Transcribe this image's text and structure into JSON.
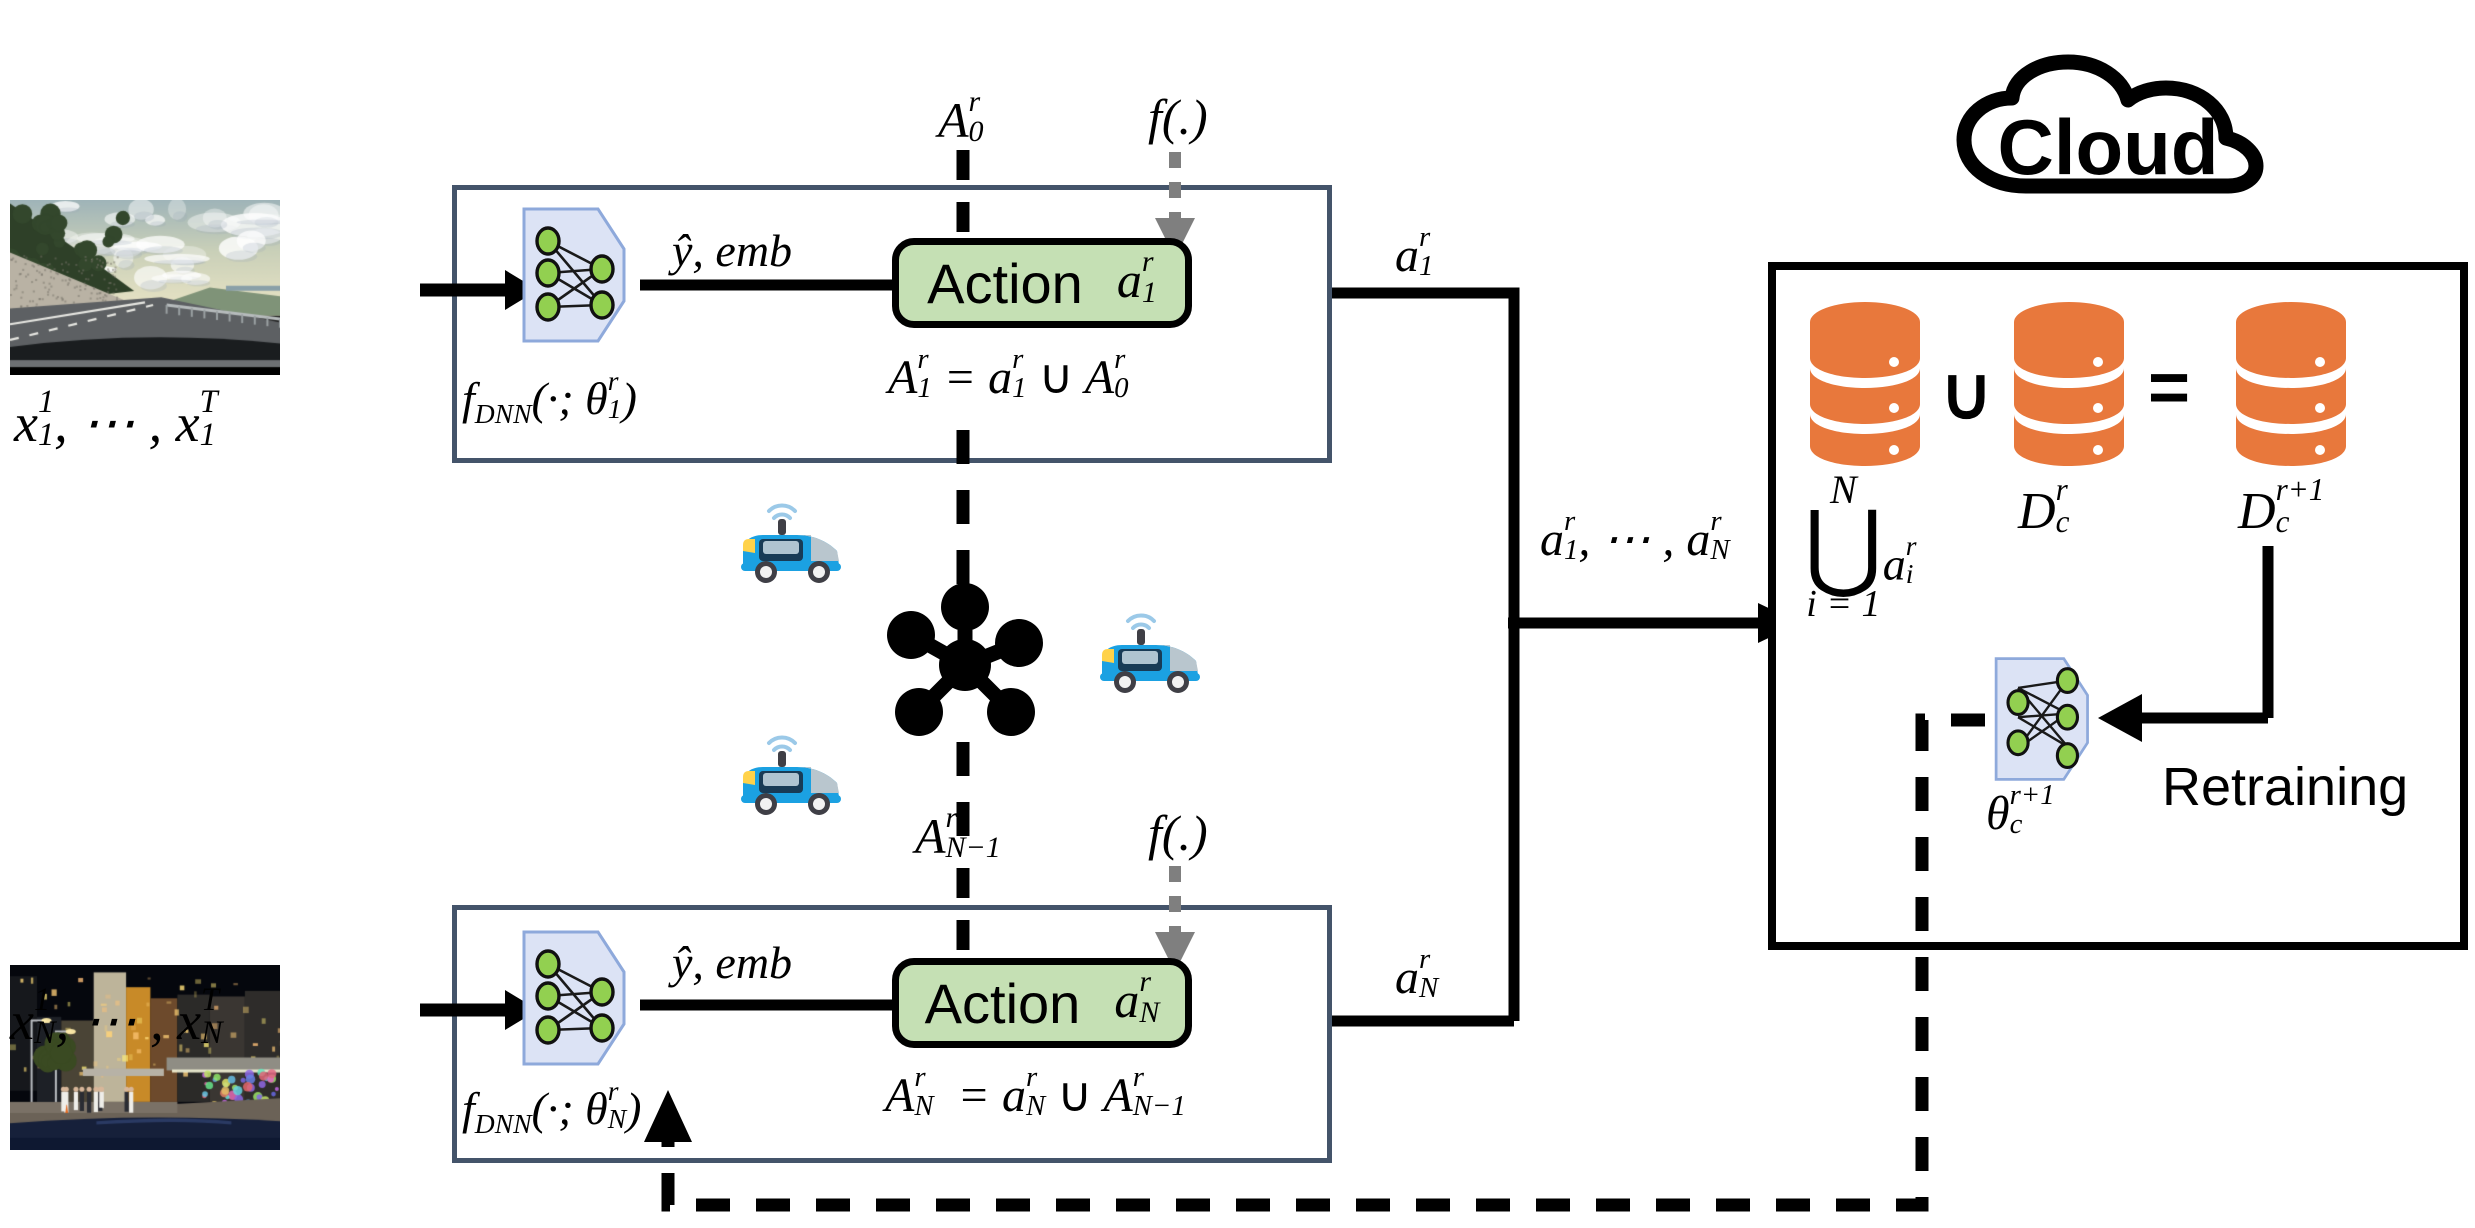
{
  "diagram": {
    "title": "Federated continual learning with edge clients and cloud retraining",
    "colors": {
      "client_border": "#44546A",
      "action_fill": "#C5E0B4",
      "action_border": "#000000",
      "dnn_panel_fill": "#DCE3F5",
      "dnn_panel_border": "#8EA9DB",
      "dnn_node_fill": "#92D050",
      "database_orange": "#E8783C",
      "cloud_border": "#000000",
      "gray_arrow": "#7F7F7F",
      "car_blue": "#1BA1E2"
    }
  },
  "inputs": [
    {
      "id": "client-1",
      "label": "x₁¹, ⋯, x₁ᵀ",
      "scene": "daytime-highway-dashcam",
      "label_parts": {
        "base": "x",
        "sup_first": "1",
        "sub_first": "1",
        "ellipsis": ", ⋯ , ",
        "sup_last": "T",
        "sub_last": "1"
      }
    },
    {
      "id": "client-N",
      "label": "xₙ¹, ⋯, xₙᵀ",
      "scene": "night-street-dashcam",
      "label_parts": {
        "base": "x",
        "sup_first": "1",
        "sub_first": "N",
        "ellipsis": ", ⋯ , ",
        "sup_last": "T",
        "sub_last": "N"
      }
    }
  ],
  "clients": [
    {
      "id": "client-1",
      "dnn_label": {
        "f": "f",
        "subscript": "DNN",
        "args_open": "(·; ",
        "theta": "θ",
        "theta_sup": "r",
        "theta_sub": "1",
        "args_close": ")"
      },
      "edge_label": {
        "yhat": "ŷ",
        "comma": ", ",
        "emb": "emb"
      },
      "action_word": "Action",
      "action_symbol": {
        "base": "a",
        "sup": "r",
        "sub": "1"
      },
      "buffer_in": {
        "base": "A",
        "sup": "r",
        "sub": "0"
      },
      "policy_label": "f(.)",
      "union_equation": {
        "lhs": {
          "base": "A",
          "sup": "r",
          "sub": "1"
        },
        "eq": " = ",
        "term1": {
          "base": "a",
          "sup": "r",
          "sub": "1"
        },
        "op": " ∪ ",
        "term2": {
          "base": "A",
          "sup": "r",
          "sub": "0"
        }
      },
      "out_label": {
        "base": "a",
        "sup": "r",
        "sub": "1"
      }
    },
    {
      "id": "client-N",
      "dnn_label": {
        "f": "f",
        "subscript": "DNN",
        "args_open": "(·; ",
        "theta": "θ",
        "theta_sup": "r",
        "theta_sub": "N",
        "args_close": ")"
      },
      "edge_label": {
        "yhat": "ŷ",
        "comma": ", ",
        "emb": "emb"
      },
      "action_word": "Action",
      "action_symbol": {
        "base": "a",
        "sup": "r",
        "sub": "N"
      },
      "buffer_in": {
        "base": "A",
        "sup": "r",
        "sub": "N−1"
      },
      "policy_label": "f(.)",
      "union_equation": {
        "lhs": {
          "base": "A",
          "sup": "r",
          "sub": "N"
        },
        "eq": " = ",
        "term1": {
          "base": "a",
          "sup": "r",
          "sub": "N"
        },
        "op": " ∪ ",
        "term2": {
          "base": "A",
          "sup": "r",
          "sub": "N−1"
        }
      },
      "out_label": {
        "base": "a",
        "sup": "r",
        "sub": "N"
      }
    }
  ],
  "aggregation": {
    "uplink_label": {
      "first": {
        "base": "a",
        "sup": "r",
        "sub": "1"
      },
      "ellipsis": ", ⋯ , ",
      "last": {
        "base": "a",
        "sup": "r",
        "sub": "N"
      }
    }
  },
  "cloud": {
    "title": "Cloud",
    "databases": [
      {
        "id": "db-union-actions",
        "caption": {
          "big_op": "⋃",
          "upper": "N",
          "lower": "i = 1",
          "operand_base": "a",
          "operand_sup": "r",
          "operand_sub": "i"
        }
      },
      {
        "id": "db-cloud-dataset",
        "caption": {
          "base": "D",
          "sup": "r",
          "sub": "c"
        }
      },
      {
        "id": "db-new-dataset",
        "caption": {
          "base": "D",
          "sup": "r+1",
          "sub": "c"
        }
      }
    ],
    "operators": {
      "union": "∪",
      "equals": "="
    },
    "retraining_label": "Retraining",
    "model_label": {
      "base": "θ",
      "sup": "r+1",
      "sub": "c"
    }
  },
  "network": {
    "hub_icon": "network-hub-icon",
    "vehicles": [
      {
        "id": "vehicle-1",
        "icon": "autonomous-car-icon"
      },
      {
        "id": "vehicle-2",
        "icon": "autonomous-car-icon"
      },
      {
        "id": "vehicle-3",
        "icon": "autonomous-car-icon"
      }
    ]
  }
}
